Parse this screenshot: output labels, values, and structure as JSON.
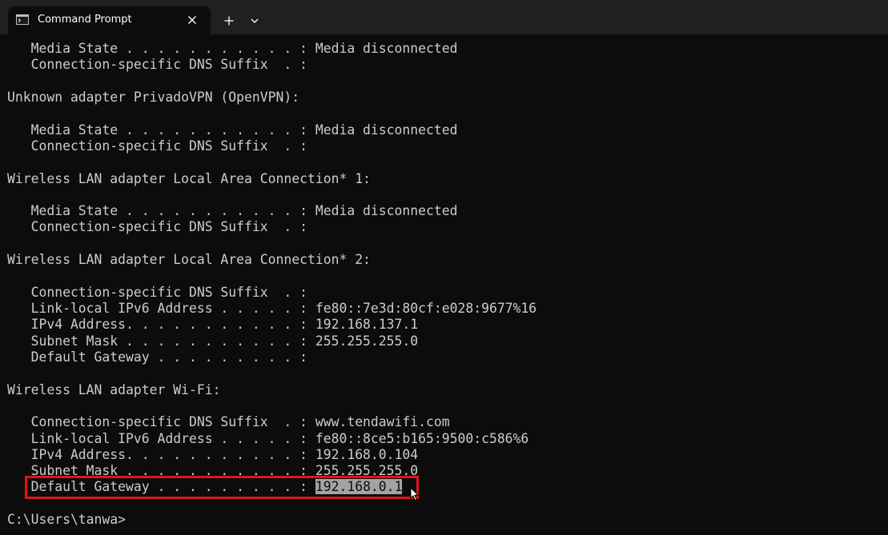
{
  "window": {
    "tab_title": "Command Prompt",
    "tab_icon": "terminal-icon",
    "close_icon": "close-icon",
    "new_tab_icon": "plus-icon",
    "dropdown_icon": "chevron-down-icon"
  },
  "terminal": {
    "lines": [
      "   Media State . . . . . . . . . . . : Media disconnected",
      "   Connection-specific DNS Suffix  . :",
      "",
      "Unknown adapter PrivadoVPN (OpenVPN):",
      "",
      "   Media State . . . . . . . . . . . : Media disconnected",
      "   Connection-specific DNS Suffix  . :",
      "",
      "Wireless LAN adapter Local Area Connection* 1:",
      "",
      "   Media State . . . . . . . . . . . : Media disconnected",
      "   Connection-specific DNS Suffix  . :",
      "",
      "Wireless LAN adapter Local Area Connection* 2:",
      "",
      "   Connection-specific DNS Suffix  . :",
      "   Link-local IPv6 Address . . . . . : fe80::7e3d:80cf:e028:9677%16",
      "   IPv4 Address. . . . . . . . . . . : 192.168.137.1",
      "   Subnet Mask . . . . . . . . . . . : 255.255.255.0",
      "   Default Gateway . . . . . . . . . :",
      "",
      "Wireless LAN adapter Wi-Fi:",
      "",
      "   Connection-specific DNS Suffix  . : www.tendawifi.com",
      "   Link-local IPv6 Address . . . . . : fe80::8ce5:b165:9500:c586%6",
      "   IPv4 Address. . . . . . . . . . . : 192.168.0.104",
      "   Subnet Mask . . . . . . . . . . . : 255.255.255.0"
    ],
    "gateway_line_label": "   Default Gateway . . . . . . . . . : ",
    "gateway_value": "192.168.0.1",
    "blank_before_prompt": "",
    "prompt": "C:\\Users\\tanwa>"
  },
  "colors": {
    "background": "#0c0c0c",
    "titlebar": "#202020",
    "text": "#cccccc",
    "selection": "#a3a3a3",
    "highlight_box": "#e0141c"
  }
}
